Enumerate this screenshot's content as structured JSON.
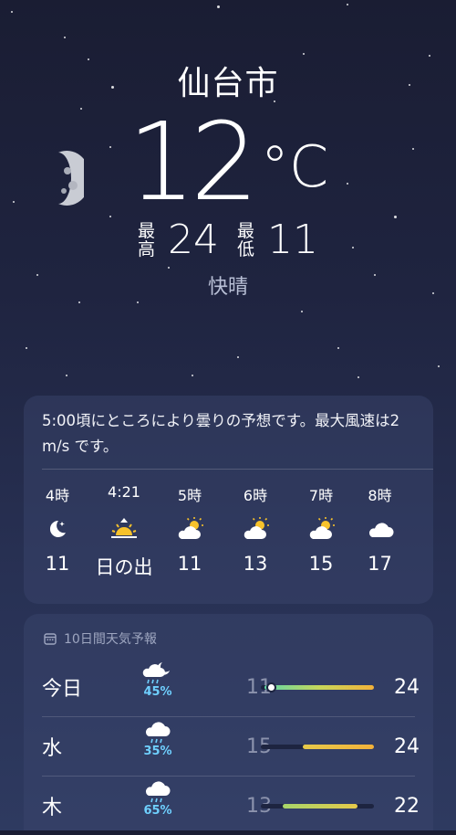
{
  "location": {
    "city": "仙台市",
    "temperature": "12",
    "unit": "°C"
  },
  "hilo": {
    "high_label_1": "最",
    "high_label_2": "高",
    "high": "24",
    "low_label_1": "最",
    "low_label_2": "低",
    "low": "11"
  },
  "condition": "快晴",
  "summary": "5:00頃にところにより曇りの予想です。最大風速は2 m/s です。",
  "hourly": [
    {
      "time": "4時",
      "icon": "moon-stars-icon",
      "temp": "11"
    },
    {
      "time": "4:21",
      "icon": "sunrise-icon",
      "temp": "日の出"
    },
    {
      "time": "5時",
      "icon": "partly-cloudy-icon",
      "temp": "11"
    },
    {
      "time": "6時",
      "icon": "partly-cloudy-icon",
      "temp": "13"
    },
    {
      "time": "7時",
      "icon": "partly-cloudy-icon",
      "temp": "15"
    },
    {
      "time": "8時",
      "icon": "cloud-icon",
      "temp": "17"
    }
  ],
  "forecast": {
    "title": "10日間天気予報",
    "days": [
      {
        "day": "今日",
        "icon": "rain-moon-icon",
        "pop": "45%",
        "low": "11",
        "high": "24",
        "range": [
          0.0,
          1.0
        ],
        "current": 0.08
      },
      {
        "day": "水",
        "icon": "rain-cloud-icon",
        "pop": "35%",
        "low": "15",
        "high": "24",
        "range": [
          0.33,
          0.95
        ]
      },
      {
        "day": "木",
        "icon": "rain-cloud-icon",
        "pop": "65%",
        "low": "13",
        "high": "22",
        "range": [
          0.18,
          0.82
        ]
      }
    ]
  },
  "colors": {
    "accent_pop": "#6fd0ff",
    "sun": "#f7c22b"
  }
}
